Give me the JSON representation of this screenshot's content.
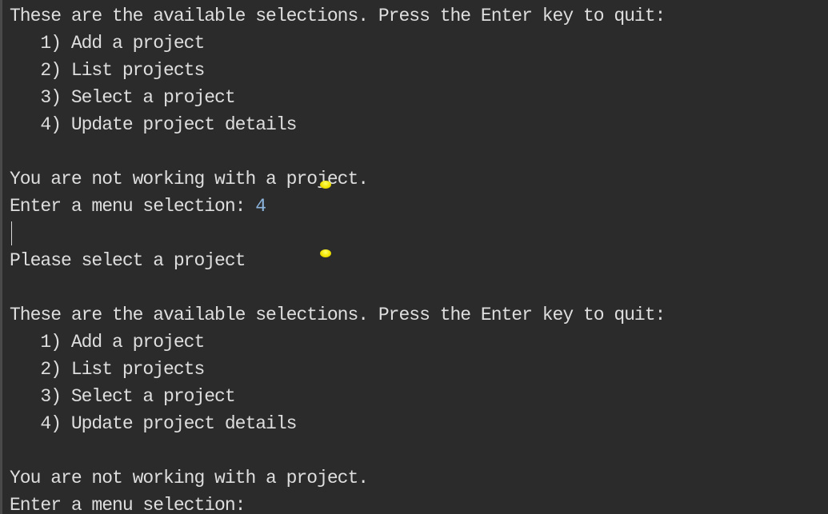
{
  "console": {
    "lines": [
      {
        "text": "These are the available selections. Press the Enter key to quit:"
      },
      {
        "text": "   1) Add a project"
      },
      {
        "text": "   2) List projects"
      },
      {
        "text": "   3) Select a project"
      },
      {
        "text": "   4) Update project details"
      },
      {
        "text": ""
      },
      {
        "text": "You are not working with a project."
      },
      {
        "text": "Enter a menu selection: ",
        "input": "4"
      },
      {
        "text": ""
      },
      {
        "text": "Please select a project"
      },
      {
        "text": ""
      },
      {
        "text": "These are the available selections. Press the Enter key to quit:"
      },
      {
        "text": "   1) Add a project"
      },
      {
        "text": "   2) List projects"
      },
      {
        "text": "   3) Select a project"
      },
      {
        "text": "   4) Update project details"
      },
      {
        "text": ""
      },
      {
        "text": "You are not working with a project."
      },
      {
        "text": "Enter a menu selection:"
      }
    ]
  },
  "colors": {
    "background": "#2b2b2b",
    "text": "#dedede",
    "user_input": "#8cb4dc",
    "mouse_marker": "#f2e600"
  }
}
